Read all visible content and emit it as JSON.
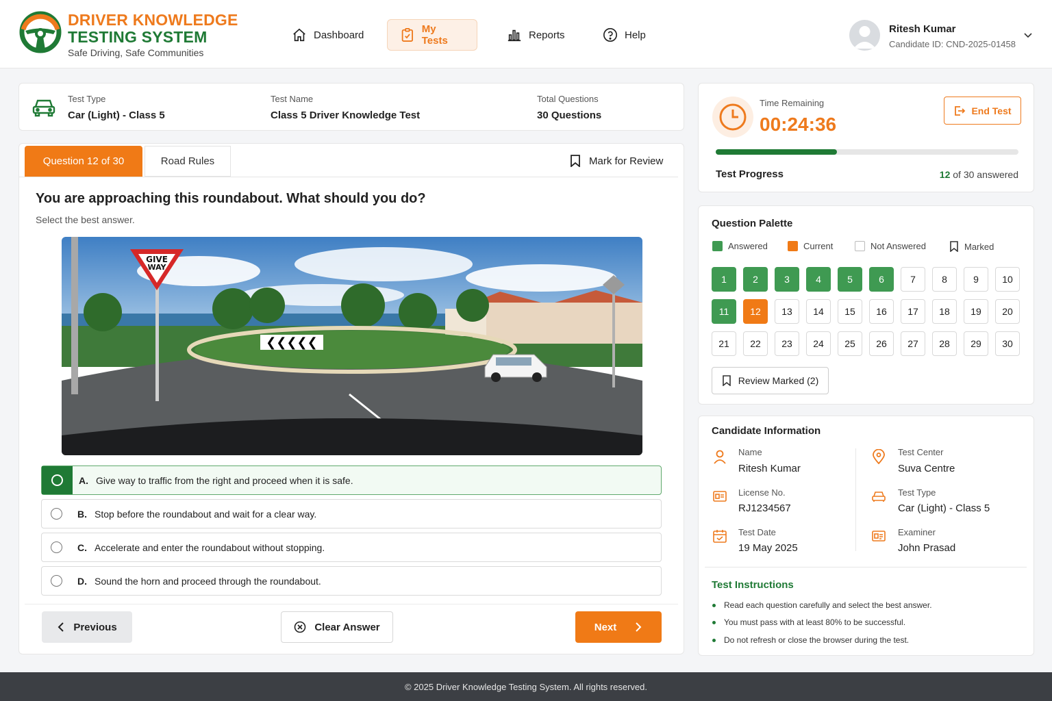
{
  "brand": {
    "line1": "DRIVER KNOWLEDGE",
    "line2": "TESTING SYSTEM",
    "tagline": "Safe Driving, Safe Communities"
  },
  "nav": [
    {
      "label": "Dashboard",
      "icon": "home-icon"
    },
    {
      "label": "My Tests",
      "icon": "clipboard-icon",
      "active": true
    },
    {
      "label": "Reports",
      "icon": "bar-chart-icon"
    },
    {
      "label": "Help",
      "icon": "help-circle-icon"
    }
  ],
  "user": {
    "name": "Ritesh Kumar",
    "id": "Candidate ID: CND-2025-01458"
  },
  "summary": {
    "test_type_label": "Test Type",
    "test_type": "Car (Light) - Class 5",
    "test_name_label": "Test Name",
    "test_name": "Class 5 Driver Knowledge Test",
    "total_label": "Total Questions",
    "total": "30 Questions"
  },
  "tabs": {
    "question": "Question 12 of 30",
    "category": "Road Rules",
    "mark": "Mark for Review"
  },
  "question": {
    "text": "You are approaching this roundabout. What should you do?",
    "sub": "Select the best answer.",
    "sign_text_1": "GIVE",
    "sign_text_2": "WAY",
    "options": [
      {
        "letter": "A.",
        "text": "Give way to traffic from the right and proceed when it is safe.",
        "selected": true
      },
      {
        "letter": "B.",
        "text": "Stop before the roundabout and wait for a clear way."
      },
      {
        "letter": "C.",
        "text": "Accelerate and enter the roundabout without stopping."
      },
      {
        "letter": "D.",
        "text": "Sound the horn and proceed through the roundabout."
      }
    ]
  },
  "actions": {
    "previous": "Previous",
    "clear": "Clear Answer",
    "next": "Next"
  },
  "timer": {
    "label": "Time Remaining",
    "value": "00:24:36",
    "end": "End Test",
    "progress_label": "Test Progress",
    "answered": 12,
    "total": 30,
    "answered_count": "12",
    "answered_suffix": "of 30 answered"
  },
  "palette": {
    "title": "Question Palette",
    "legend": {
      "answered": "Answered",
      "current": "Current",
      "not_answered": "Not Answered",
      "marked": "Marked"
    },
    "answered": [
      1,
      2,
      3,
      4,
      5,
      6,
      11
    ],
    "current": 12,
    "count": 30,
    "review": "Review Marked (2)"
  },
  "candidate": {
    "title": "Candidate Information",
    "fields": [
      {
        "label": "Name",
        "value": "Ritesh Kumar",
        "icon": "user-icon"
      },
      {
        "label": "Test Center",
        "value": "Suva Centre",
        "icon": "location-pin-icon"
      },
      {
        "label": "License No.",
        "value": "RJ1234567",
        "icon": "id-card-icon"
      },
      {
        "label": "Test Type",
        "value": "Car (Light) - Class 5",
        "icon": "car-icon"
      },
      {
        "label": "Test Date",
        "value": "19 May 2025",
        "icon": "calendar-icon"
      },
      {
        "label": "Examiner",
        "value": "John Prasad",
        "icon": "badge-icon"
      }
    ]
  },
  "instructions": {
    "title": "Test Instructions",
    "items": [
      "Read each question carefully and select the best answer.",
      "You must pass with at least 80% to be successful.",
      "Do not refresh or close the browser during the test."
    ]
  },
  "footer": "© 2025 Driver Knowledge Testing System. All rights reserved.",
  "colors": {
    "brand_orange": "#ee7a1d",
    "brand_green": "#1f7a35",
    "answered": "#3f9a52"
  }
}
